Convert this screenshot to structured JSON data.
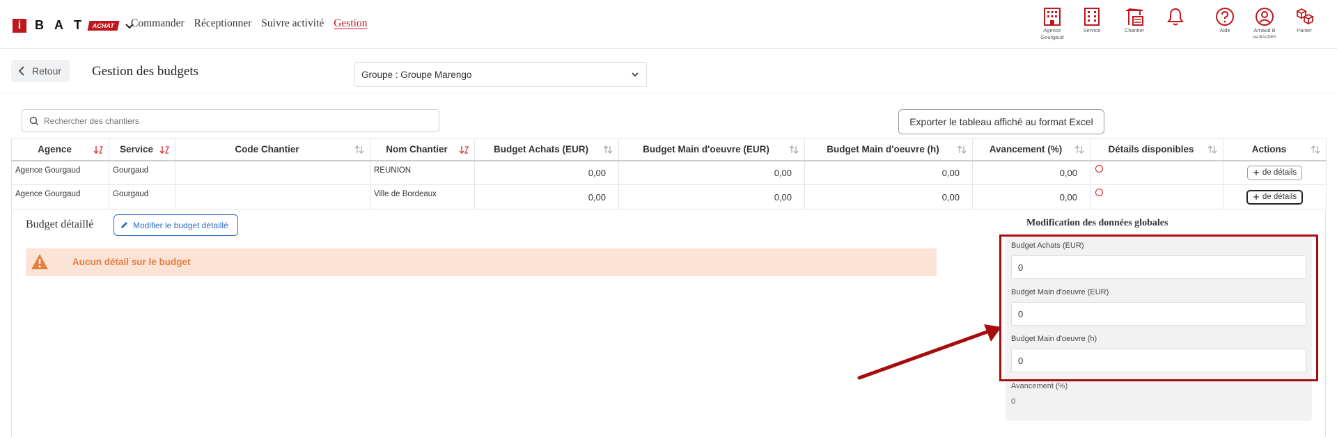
{
  "brand": {
    "logo_i": "i",
    "logo_letters": [
      "B",
      "A",
      "T"
    ],
    "logo_badge": "ACHAT",
    "accent_color": "#c0161d"
  },
  "nav": {
    "items": [
      {
        "label": "Commander",
        "active": false
      },
      {
        "label": "Réceptionner",
        "active": false
      },
      {
        "label": "Suivre activité",
        "active": false
      },
      {
        "label": "Gestion",
        "active": true
      }
    ]
  },
  "top_icons": [
    {
      "icon": "building-icon",
      "label_line1": "Agence",
      "label_line2": "Gourgaud"
    },
    {
      "icon": "building-grid-icon",
      "label_line1": "Service",
      "label_line2": ""
    },
    {
      "icon": "crane-icon",
      "label_line1": "Chantier",
      "label_line2": ""
    },
    {
      "icon": "bell-icon",
      "label_line1": "",
      "label_line2": ""
    },
    {
      "icon": "help-icon",
      "label_line1": "Aide",
      "label_line2": ""
    },
    {
      "icon": "user-icon",
      "label_line1": "Arnaud B",
      "label_line2": "via BAUDRY"
    },
    {
      "icon": "cart-icon",
      "label_line1": "Panier",
      "label_line2": ""
    }
  ],
  "subheader": {
    "back_label": "Retour",
    "title": "Gestion des budgets",
    "group_select": "Groupe : Groupe Marengo"
  },
  "toolbar": {
    "search_placeholder": "Rechercher des chantiers",
    "export_label": "Exporter le tableau affiché au format Excel"
  },
  "table": {
    "headers": [
      "Agence",
      "Service",
      "Code Chantier",
      "Nom Chantier",
      "Budget Achats (EUR)",
      "Budget Main d'oeuvre (EUR)",
      "Budget Main d'oeuvre (h)",
      "Avancement (%)",
      "Détails disponibles",
      "Actions"
    ],
    "rows": [
      {
        "agence": "Agence Gourgaud",
        "service": "Gourgaud",
        "code": "",
        "nom": "REUNION",
        "budget_achats": "0,00",
        "budget_mo_eur": "0,00",
        "budget_mo_h": "0,00",
        "avancement": "0,00",
        "action": "de détails"
      },
      {
        "agence": "Agence Gourgaud",
        "service": "Gourgaud",
        "code": "",
        "nom": "Ville de Bordeaux",
        "budget_achats": "0,00",
        "budget_mo_eur": "0,00",
        "budget_mo_h": "0,00",
        "avancement": "0,00",
        "action": "de détails"
      }
    ]
  },
  "detail": {
    "title": "Budget détaillé",
    "modify_label": "Modifier le budget détaillé",
    "alert_text": "Aucun détail sur le budget",
    "global_title": "Modification des données globales",
    "fields": [
      {
        "label": "Budget Achats (EUR)",
        "value": "0"
      },
      {
        "label": "Budget Main d'oeuvre (EUR)",
        "value": "0"
      },
      {
        "label": "Budget Main d'oeuvre (h)",
        "value": "0"
      }
    ],
    "avancement_label": "Avancement (%)",
    "avancement_value": "0"
  }
}
